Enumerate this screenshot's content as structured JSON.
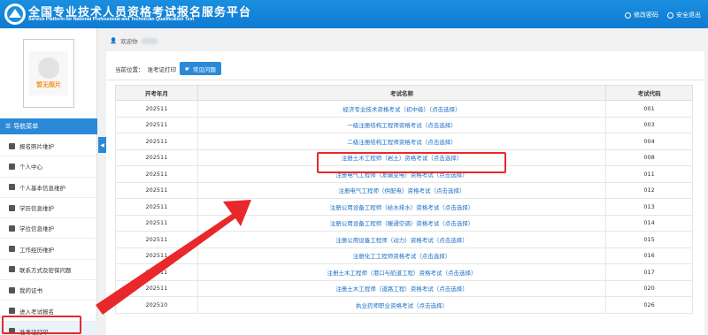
{
  "header": {
    "title_cn": "全国专业技术人员资格考试报名服务平台",
    "title_en": "Service Platform for National Professional and Technician Qualification Test",
    "links": [
      {
        "label": "修改密码",
        "icon": "gear-icon"
      },
      {
        "label": "安全退出",
        "icon": "power-icon"
      }
    ]
  },
  "sidebar": {
    "photo_text": "暂无照片",
    "nav_header": "导航菜单",
    "items": [
      {
        "label": "报名照片维护",
        "icon": "photo-icon"
      },
      {
        "label": "个人中心",
        "icon": "user-icon"
      },
      {
        "label": "个人基本信息维护",
        "icon": "user-icon"
      },
      {
        "label": "学历信息维护",
        "icon": "graduation-icon"
      },
      {
        "label": "学位信息维护",
        "icon": "graduation-icon"
      },
      {
        "label": "工作经历维护",
        "icon": "briefcase-icon"
      },
      {
        "label": "联系方式及密保问题",
        "icon": "phone-icon"
      },
      {
        "label": "我的证书",
        "icon": "certificate-icon"
      },
      {
        "label": "进入考试报名",
        "icon": "enter-icon"
      },
      {
        "label": "准考证打印",
        "icon": "print-icon"
      }
    ],
    "collapse_glyph": "◀"
  },
  "welcome": {
    "label": "欢迎你"
  },
  "breadcrumb": {
    "prefix": "当前位置：",
    "current": "准考证打印",
    "faq_label": "常见问题"
  },
  "table": {
    "headers": [
      "开考年月",
      "考试名称",
      "考试代码"
    ],
    "rows": [
      {
        "date": "202511",
        "name": "经济专业技术资格考试（初中级）（点击选择）",
        "code": "001"
      },
      {
        "date": "202511",
        "name": "一级注册结构工程师资格考试（点击选择）",
        "code": "003"
      },
      {
        "date": "202511",
        "name": "二级注册结构工程师资格考试（点击选择）",
        "code": "004"
      },
      {
        "date": "202511",
        "name": "注册土木工程师（岩土）资格考试（点击选择）",
        "code": "008"
      },
      {
        "date": "202511",
        "name": "注册电气工程师（发输变电）资格考试（点击选择）",
        "code": "011"
      },
      {
        "date": "202511",
        "name": "注册电气工程师（供配电）资格考试（点击选择）",
        "code": "012"
      },
      {
        "date": "202511",
        "name": "注册公用设备工程师（给水排水）资格考试（点击选择）",
        "code": "013"
      },
      {
        "date": "202511",
        "name": "注册公用设备工程师（暖通空调）资格考试（点击选择）",
        "code": "014"
      },
      {
        "date": "202511",
        "name": "注册公用设备工程师（动力）资格考试（点击选择）",
        "code": "015"
      },
      {
        "date": "202511",
        "name": "注册化工工程师资格考试（点击选择）",
        "code": "016"
      },
      {
        "date": "202511",
        "name": "注册土木工程师（港口与航道工程）资格考试（点击选择）",
        "code": "017"
      },
      {
        "date": "202511",
        "name": "注册土木工程师（道路工程）资格考试（点击选择）",
        "code": "020"
      },
      {
        "date": "202510",
        "name": "执业药师职业资格考试（点击选择）",
        "code": "026"
      }
    ]
  },
  "colors": {
    "brand": "#1a8ee0",
    "highlight": "#e8282b",
    "link": "#1a6fc4"
  }
}
